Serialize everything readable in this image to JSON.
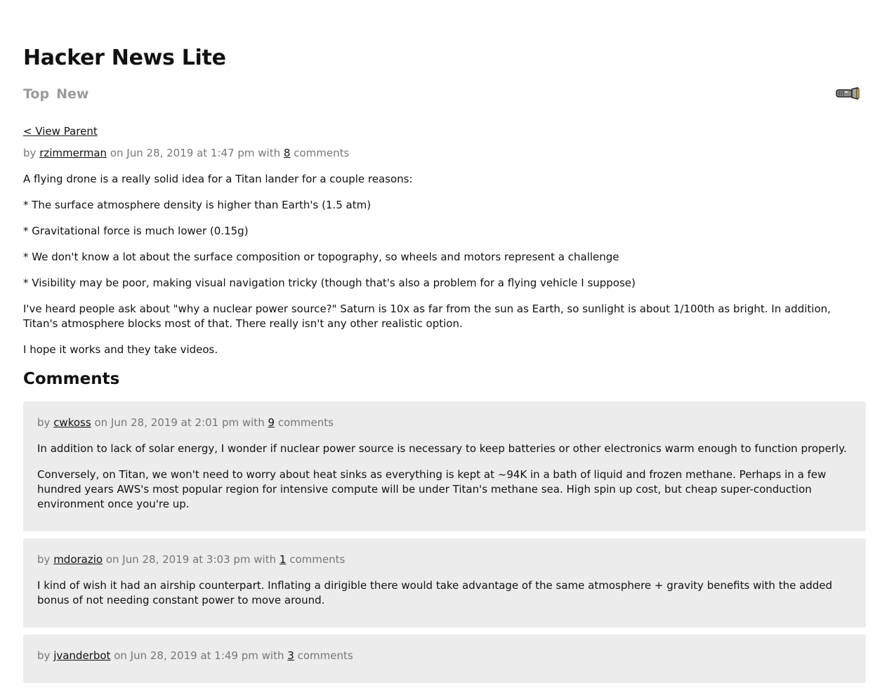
{
  "app": {
    "title": "Hacker News Lite",
    "nav": [
      {
        "label": "Top"
      },
      {
        "label": "New"
      }
    ],
    "theme_toggle_icon": "flashlight-icon"
  },
  "story": {
    "view_parent_label": "< View Parent",
    "meta": {
      "by_prefix": "by",
      "author": "rzimmerman",
      "date_text": "on Jun 28, 2019 at 1:47 pm with",
      "comment_count": "8",
      "comments_suffix": "comments"
    },
    "paragraphs": [
      "A flying drone is a really solid idea for a Titan lander for a couple reasons:",
      "* The surface atmosphere density is higher than Earth's (1.5 atm)",
      "* Gravitational force is much lower (0.15g)",
      "* We don't know a lot about the surface composition or topography, so wheels and motors represent a challenge",
      "* Visibility may be poor, making visual navigation tricky (though that's also a problem for a flying vehicle I suppose)",
      "I've heard people ask about \"why a nuclear power source?\" Saturn is 10x as far from the sun as Earth, so sunlight is about 1/100th as bright. In addition, Titan's atmosphere blocks most of that. There really isn't any other realistic option.",
      "I hope it works and they take videos."
    ]
  },
  "comments_heading": "Comments",
  "comments": [
    {
      "by_prefix": "by",
      "author": "cwkoss",
      "date_text": "on Jun 28, 2019 at 2:01 pm with",
      "comment_count": "9",
      "comments_suffix": "comments",
      "paragraphs": [
        "In addition to lack of solar energy, I wonder if nuclear power source is necessary to keep batteries or other electronics warm enough to function properly.",
        "Conversely, on Titan, we won't need to worry about heat sinks as everything is kept at ~94K in a bath of liquid and frozen methane. Perhaps in a few hundred years AWS's most popular region for intensive compute will be under Titan's methane sea. High spin up cost, but cheap super-conduction environment once you're up."
      ]
    },
    {
      "by_prefix": "by",
      "author": "mdorazio",
      "date_text": "on Jun 28, 2019 at 3:03 pm with",
      "comment_count": "1",
      "comments_suffix": "comments",
      "paragraphs": [
        "I kind of wish it had an airship counterpart. Inflating a dirigible there would take advantage of the same atmosphere + gravity benefits with the added bonus of not needing constant power to move around."
      ]
    },
    {
      "by_prefix": "by",
      "author": "jvanderbot",
      "date_text": "on Jun 28, 2019 at 1:49 pm with",
      "comment_count": "3",
      "comments_suffix": "comments",
      "paragraphs": []
    }
  ]
}
